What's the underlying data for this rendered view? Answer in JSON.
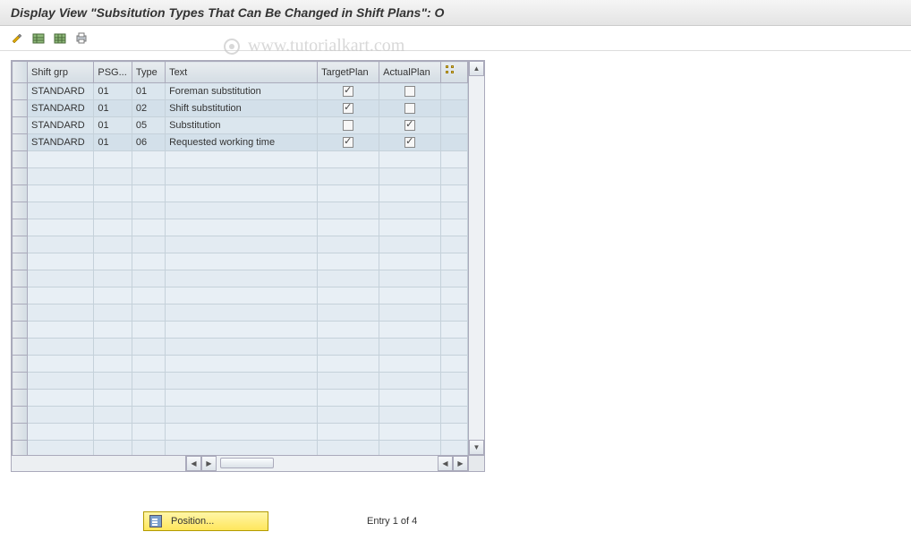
{
  "title": "Display View \"Subsitution Types That Can Be Changed in Shift Plans\": O",
  "watermark": "www.tutorialkart.com",
  "columns": {
    "shift_grp": "Shift grp",
    "psg": "PSG...",
    "type": "Type",
    "text": "Text",
    "target": "TargetPlan",
    "actual": "ActualPlan"
  },
  "rows": [
    {
      "shift_grp": "STANDARD",
      "psg": "01",
      "type": "01",
      "text": "Foreman substitution",
      "target": true,
      "actual": false
    },
    {
      "shift_grp": "STANDARD",
      "psg": "01",
      "type": "02",
      "text": "Shift substitution",
      "target": true,
      "actual": false
    },
    {
      "shift_grp": "STANDARD",
      "psg": "01",
      "type": "05",
      "text": "Substitution",
      "target": false,
      "actual": true
    },
    {
      "shift_grp": "STANDARD",
      "psg": "01",
      "type": "06",
      "text": "Requested working time",
      "target": true,
      "actual": true
    }
  ],
  "empty_rows": 18,
  "position_button": "Position...",
  "entry_text": "Entry 1 of 4"
}
